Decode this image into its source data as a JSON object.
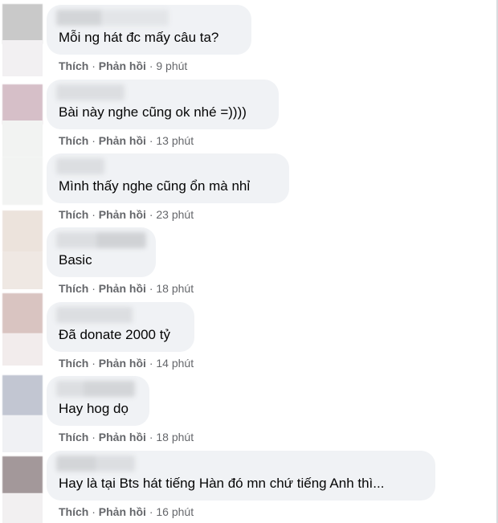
{
  "comments": [
    {
      "text": "Mỗi ng hát đc mấy câu ta?",
      "like": "Thích",
      "reply": "Phản hồi",
      "time": "9 phút",
      "avatar_color": "#c9c9c9",
      "avatar_fade": "#f2f0f2"
    },
    {
      "text": "Bài này nghe cũng ok nhé =))))",
      "like": "Thích",
      "reply": "Phản hồi",
      "time": "13 phút",
      "avatar_color": "#d6bfc8",
      "avatar_fade": "#f2f3f2"
    },
    {
      "text": "Mình thấy nghe cũng ổn mà nhỉ",
      "like": "Thích",
      "reply": "Phản hồi",
      "time": "23 phút",
      "avatar_color": "#f2f3f2",
      "avatar_fade": "#f2f3f2"
    },
    {
      "text": "Basic",
      "like": "Thích",
      "reply": "Phản hồi",
      "time": "18 phút",
      "avatar_color": "#ece3dc",
      "avatar_fade": "#efe8e3"
    },
    {
      "text": "Đã donate 2000 tỷ",
      "like": "Thích",
      "reply": "Phản hồi",
      "time": "14 phút",
      "avatar_color": "#d9c4c1",
      "avatar_fade": "#f2ecec"
    },
    {
      "text": "Hay hog dọ",
      "like": "Thích",
      "reply": "Phản hồi",
      "time": "18 phút",
      "avatar_color": "#c2c6d2",
      "avatar_fade": "#f0f1f4"
    },
    {
      "text": "Hay là tại Bts hát tiếng Hàn đó mn chứ tiếng Anh thì...",
      "like": "Thích",
      "reply": "Phản hồi",
      "time": "16 phút",
      "avatar_color": "#a3989a",
      "avatar_fade": "#f2f0f1"
    }
  ],
  "separator": "·"
}
